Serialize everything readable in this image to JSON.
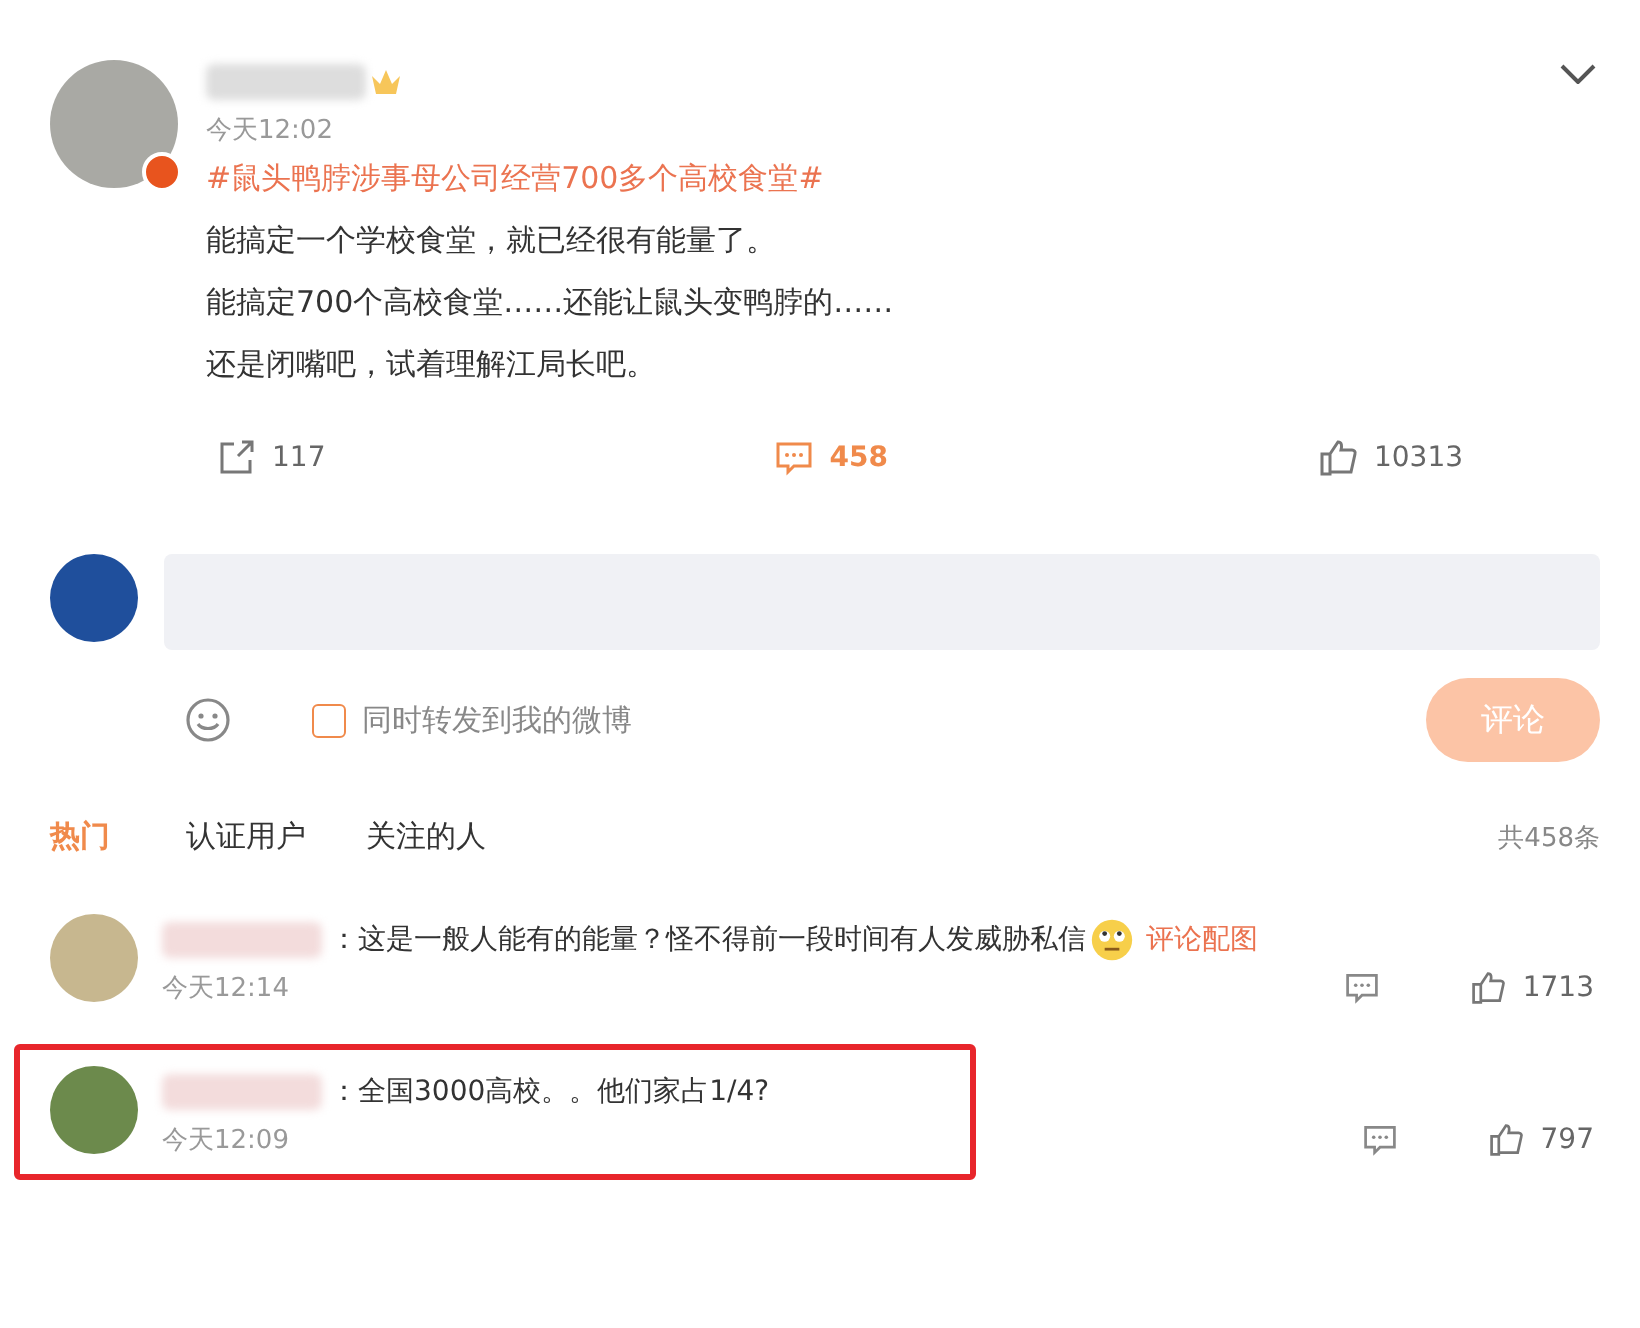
{
  "post": {
    "time": "今天12:02",
    "hashtag": "#鼠头鸭脖涉事母公司经营700多个高校食堂#",
    "lines": [
      "能搞定一个学校食堂，就已经很有能量了。",
      "能搞定700个高校食堂……还能让鼠头变鸭脖的……",
      "还是闭嘴吧，试着理解江局长吧。"
    ],
    "reposts": "117",
    "comments": "458",
    "likes": "10313"
  },
  "composer": {
    "also_repost_label": "同时转发到我的微博",
    "also_repost_checked": false,
    "submit": "评论"
  },
  "tabs": [
    {
      "label": "热门",
      "selected": true
    },
    {
      "label": "认证用户",
      "selected": false
    },
    {
      "label": "关注的人",
      "selected": false
    }
  ],
  "total": "共458条",
  "comments": [
    {
      "text": "：这是一般人能有的能量？怪不得前一段时间有人发威胁私信",
      "emoji": true,
      "link": "评论配图",
      "time": "今天12:14",
      "likes": "1713",
      "highlighted": false
    },
    {
      "text": "：全国3000高校。。他们家占1/4?",
      "emoji": false,
      "time": "今天12:09",
      "likes": "797",
      "highlighted": true
    }
  ]
}
